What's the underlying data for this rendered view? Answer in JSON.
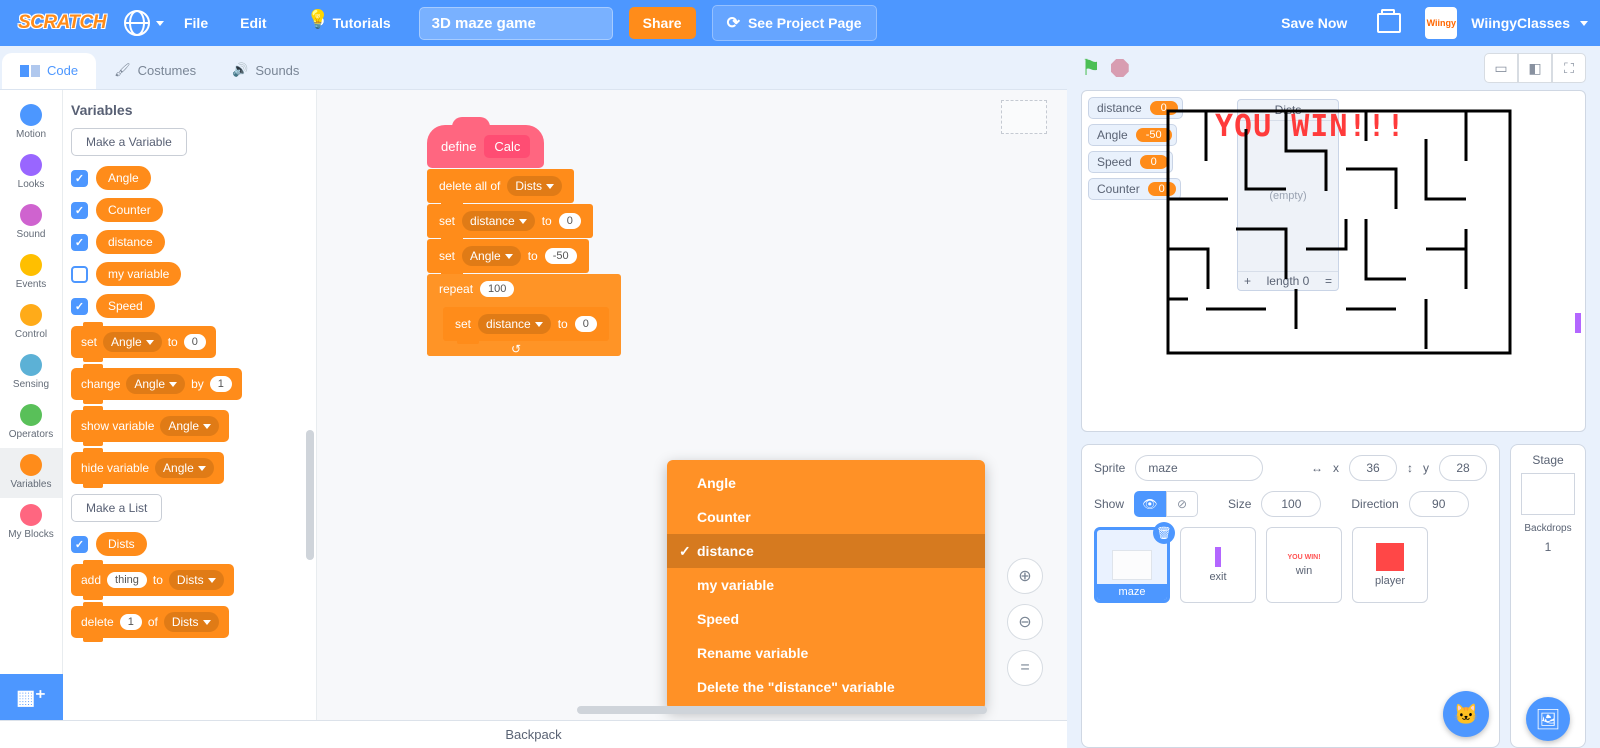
{
  "topbar": {
    "logo": "SCRATCH",
    "file": "File",
    "edit": "Edit",
    "tutorials": "Tutorials",
    "project_title": "3D maze game",
    "share": "Share",
    "see_project": "See Project Page",
    "save_now": "Save Now",
    "username": "WiingyClasses",
    "avatar": "Wiingy"
  },
  "tabs": {
    "code": "Code",
    "costumes": "Costumes",
    "sounds": "Sounds"
  },
  "categories": [
    {
      "name": "Motion",
      "color": "#4c97ff"
    },
    {
      "name": "Looks",
      "color": "#9966ff"
    },
    {
      "name": "Sound",
      "color": "#cf63cf"
    },
    {
      "name": "Events",
      "color": "#ffbf00"
    },
    {
      "name": "Control",
      "color": "#ffab19"
    },
    {
      "name": "Sensing",
      "color": "#5cb1d6"
    },
    {
      "name": "Operators",
      "color": "#59c059"
    },
    {
      "name": "Variables",
      "color": "#ff8c1a"
    },
    {
      "name": "My Blocks",
      "color": "#ff6680"
    }
  ],
  "palette": {
    "title": "Variables",
    "make_var": "Make a Variable",
    "vars": [
      {
        "label": "Angle",
        "checked": true
      },
      {
        "label": "Counter",
        "checked": true
      },
      {
        "label": "distance",
        "checked": true
      },
      {
        "label": "my variable",
        "checked": false
      },
      {
        "label": "Speed",
        "checked": true
      }
    ],
    "set_block": {
      "op": "set",
      "var": "Angle",
      "to": "to",
      "val": "0"
    },
    "change_block": {
      "op": "change",
      "var": "Angle",
      "by": "by",
      "val": "1"
    },
    "show_block": {
      "op": "show variable",
      "var": "Angle"
    },
    "hide_block": {
      "op": "hide variable",
      "var": "Angle"
    },
    "make_list": "Make a List",
    "list_var": {
      "label": "Dists",
      "checked": true
    },
    "add_block": {
      "op": "add",
      "val": "thing",
      "to": "to",
      "list": "Dists"
    },
    "del_block": {
      "op": "delete",
      "val": "1",
      "of": "of",
      "list": "Dists"
    }
  },
  "script": {
    "define": "define",
    "calc": "Calc",
    "b1": {
      "op": "delete all of",
      "list": "Dists"
    },
    "b2": {
      "op": "set",
      "var": "distance",
      "to": "to",
      "val": "0"
    },
    "b3": {
      "op": "set",
      "var": "Angle",
      "to": "to",
      "val": "-50"
    },
    "rep": {
      "op": "repeat",
      "n": "100"
    },
    "b4": {
      "op": "set",
      "var": "distance",
      "to": "to",
      "val": "0"
    }
  },
  "context_menu": {
    "items": [
      "Angle",
      "Counter",
      "distance",
      "my variable",
      "Speed",
      "Rename variable",
      "Delete the \"distance\" variable"
    ],
    "selected": "distance"
  },
  "stage": {
    "monitors": [
      {
        "label": "distance",
        "val": "0"
      },
      {
        "label": "Angle",
        "val": "-50"
      },
      {
        "label": "Speed",
        "val": "0"
      },
      {
        "label": "Counter",
        "val": "0"
      }
    ],
    "list": {
      "title": "Dists",
      "empty": "(empty)",
      "plus": "+",
      "length": "length 0",
      "eq": "="
    },
    "win_text": "YOU WIN!!!"
  },
  "sprite_info": {
    "sprite_lbl": "Sprite",
    "sprite_name": "maze",
    "x_lbl": "x",
    "x": "36",
    "y_lbl": "y",
    "y": "28",
    "show_lbl": "Show",
    "size_lbl": "Size",
    "size": "100",
    "dir_lbl": "Direction",
    "dir": "90",
    "sprites": [
      "maze",
      "exit",
      "win",
      "player"
    ]
  },
  "stage_panel": {
    "title": "Stage",
    "backdrops_lbl": "Backdrops",
    "backdrops_n": "1"
  },
  "backpack": "Backpack"
}
